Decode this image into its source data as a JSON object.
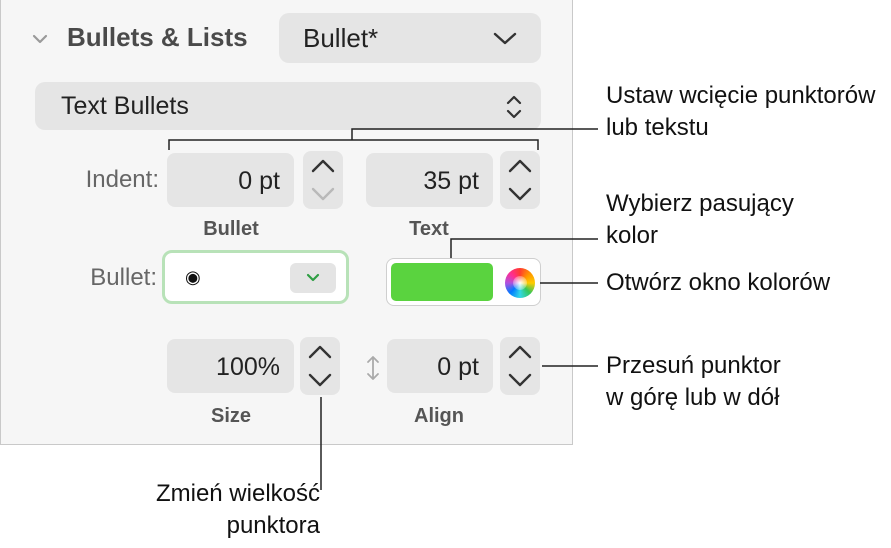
{
  "section": {
    "title": "Bullets & Lists",
    "style_popup": "Bullet*",
    "type_popup": "Text Bullets"
  },
  "indent": {
    "label": "Indent:",
    "bullet_value": "0 pt",
    "text_value": "35 pt",
    "bullet_caption": "Bullet",
    "text_caption": "Text"
  },
  "bullet": {
    "label": "Bullet:",
    "glyph": "◉",
    "color_hex": "#5ad33f"
  },
  "size": {
    "value": "100%",
    "caption": "Size"
  },
  "align": {
    "value": "0 pt",
    "caption": "Align"
  },
  "callouts": {
    "indent_line1": "Ustaw wcięcie punktorów",
    "indent_line2": "lub tekstu",
    "color_line1": "Wybierz pasujący",
    "color_line2": "kolor",
    "window": "Otwórz okno kolorów",
    "move_line1": "Przesuń punktor",
    "move_line2": "w górę lub w dół",
    "size_line1": "Zmień wielkość",
    "size_line2": "punktora"
  },
  "colors": {
    "panel_bg": "#f6f6f6",
    "control_bg": "#e5e5e5",
    "focus_ring": "#b8e2b8",
    "bullet_green": "#5ad33f"
  }
}
